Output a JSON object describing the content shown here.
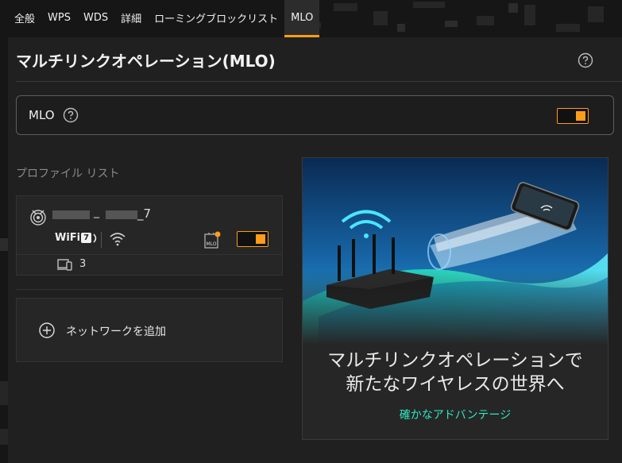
{
  "tabs": [
    {
      "label": "全般"
    },
    {
      "label": "WPS"
    },
    {
      "label": "WDS"
    },
    {
      "label": "詳細"
    },
    {
      "label": "ローミングブロックリスト"
    },
    {
      "label": "MLO"
    }
  ],
  "active_tab": "MLO",
  "page": {
    "title": "マルチリンクオペレーション(MLO)"
  },
  "mlo": {
    "label": "MLO",
    "enabled": true
  },
  "profile_list": {
    "heading": "プロファイル リスト"
  },
  "profile": {
    "ssid_separator": "_",
    "ssid_suffix": "_7",
    "wifi_standard": "WiFi",
    "wifi_generation": "7",
    "mlo_badge": "MLO",
    "enabled": true,
    "device_count": "3"
  },
  "add_network": {
    "label": "ネットワークを追加"
  },
  "promo": {
    "headline_line1": "マルチリンクオペレーションで",
    "headline_line2": "新たなワイヤレスの世界へ",
    "link": "確かなアドバンテージ"
  },
  "colors": {
    "accent": "#ff9c1a",
    "link": "#2ee6c0",
    "panel": "#202020",
    "card": "#262626"
  }
}
